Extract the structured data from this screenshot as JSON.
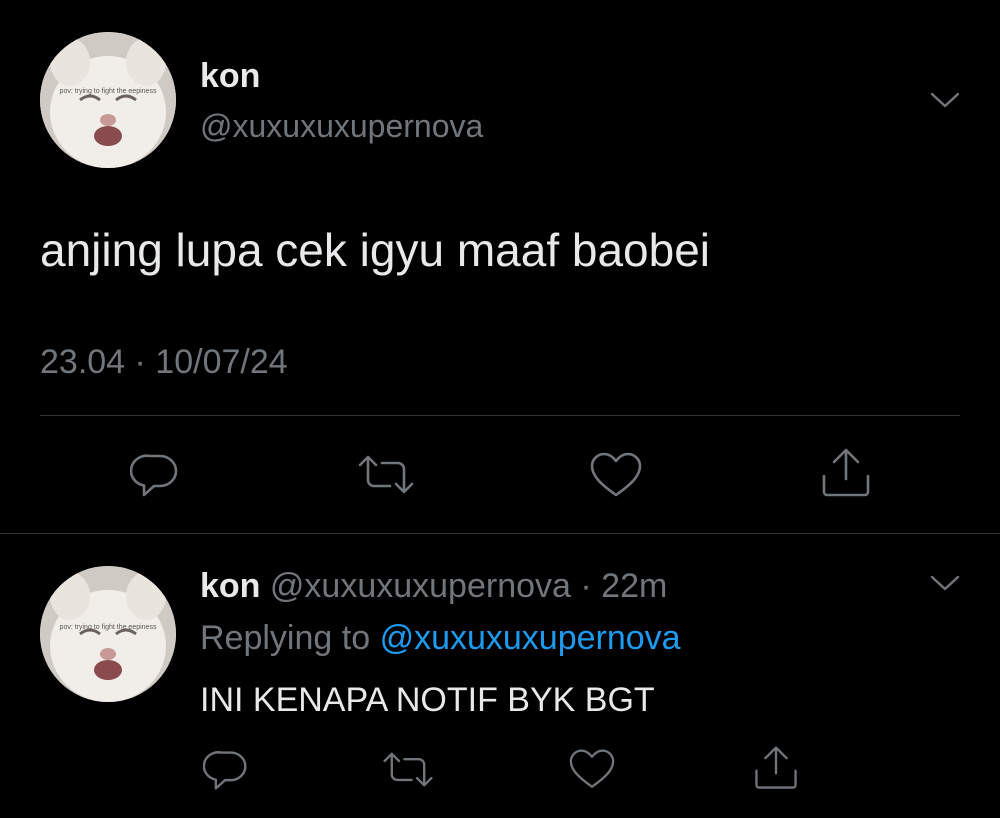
{
  "main_tweet": {
    "author_name": "kon",
    "author_handle": "@xuxuxuxupernova",
    "avatar_caption": "pov: trying to fight the eepiness",
    "text": "anjing lupa cek igyu maaf baobei",
    "timestamp": "23.04 · 10/07/24",
    "actions": [
      "reply-icon",
      "retweet-icon",
      "like-icon",
      "share-icon"
    ]
  },
  "reply_tweet": {
    "author_name": "kon",
    "author_handle": "@xuxuxuxupernova",
    "separator": "·",
    "time_ago": "22m",
    "avatar_caption": "pov: trying to fight the eepiness",
    "replying_label": "Replying to",
    "replying_handle": "@xuxuxuxupernova",
    "text": "INI KENAPA NOTIF BYK BGT",
    "actions": [
      "reply-icon",
      "retweet-icon",
      "like-icon",
      "share-icon"
    ]
  },
  "colors": {
    "background": "#000000",
    "text": "#e7e9ea",
    "muted": "#71767b",
    "link": "#1d9bf0",
    "divider": "#2f3336"
  }
}
